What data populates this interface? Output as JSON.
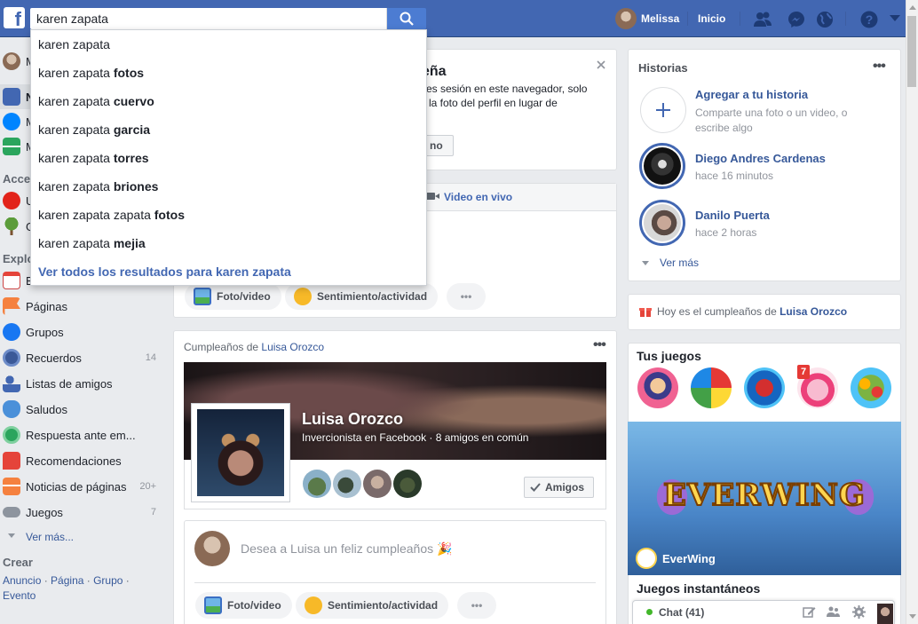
{
  "topbar": {
    "logo": "f",
    "search_value": "karen zapata",
    "user_name": "Melissa",
    "home_label": "Inicio",
    "icons": [
      "friend-requests-icon",
      "messenger-icon",
      "notifications-globe-icon",
      "help-icon",
      "account-menu-caret-icon"
    ]
  },
  "dropdown": {
    "suggestions": [
      {
        "base": "karen zapata",
        "bold": ""
      },
      {
        "base": "karen zapata ",
        "bold": "fotos"
      },
      {
        "base": "karen zapata ",
        "bold": "cuervo"
      },
      {
        "base": "karen zapata ",
        "bold": "garcia"
      },
      {
        "base": "karen zapata ",
        "bold": "torres"
      },
      {
        "base": "karen zapata ",
        "bold": "briones"
      },
      {
        "base": "karen zapata zapata ",
        "bold": "fotos"
      },
      {
        "base": "karen zapata ",
        "bold": "mejia"
      }
    ],
    "see_all": "Ver todos los resultados para karen zapata"
  },
  "left_sidebar": {
    "top_items": [
      {
        "label": "M",
        "icon": "profile-avatar-icon"
      },
      {
        "label": "N",
        "icon": "news-feed-icon"
      },
      {
        "label": "M",
        "icon": "messenger-icon"
      },
      {
        "label": "M",
        "icon": "marketplace-icon"
      }
    ],
    "shortcuts_header": "Acce",
    "shortcuts": [
      {
        "label": "U",
        "icon": "uno-game-icon"
      },
      {
        "label": "G",
        "icon": "tree-icon"
      }
    ],
    "explore_header": "Explo",
    "explore": [
      {
        "label": "E",
        "icon": "calendar-icon",
        "count": ""
      },
      {
        "label": "Páginas",
        "icon": "flag-icon",
        "count": ""
      },
      {
        "label": "Grupos",
        "icon": "groups-icon",
        "count": ""
      },
      {
        "label": "Recuerdos",
        "icon": "memories-clock-icon",
        "count": "14"
      },
      {
        "label": "Listas de amigos",
        "icon": "friend-lists-icon",
        "count": ""
      },
      {
        "label": "Saludos",
        "icon": "wave-hand-icon",
        "count": ""
      },
      {
        "label": "Respuesta ante em...",
        "icon": "crisis-response-icon",
        "count": ""
      },
      {
        "label": "Recomendaciones",
        "icon": "recommendations-icon",
        "count": ""
      },
      {
        "label": "Noticias de páginas",
        "icon": "pages-feed-icon",
        "count": "20+"
      },
      {
        "label": "Juegos",
        "icon": "gamepad-icon",
        "count": "7"
      }
    ],
    "see_more": "Ver más...",
    "create_header": "Crear",
    "create_links": [
      "Anuncio",
      "Página",
      "Grupo",
      "Evento"
    ]
  },
  "password_card": {
    "title": "eña",
    "text_line1": "es sesión en este navegador, solo",
    "text_line2": "la foto del perfil en lugar de",
    "button": "no"
  },
  "composer": {
    "live_label": "Video en vivo",
    "photo_label": "Foto/video",
    "feeling_label": "Sentimiento/actividad"
  },
  "birthday_card": {
    "header_prefix": "Cumpleaños de ",
    "header_name": "Luisa Orozco",
    "name": "Luisa Orozco",
    "subtitle": "Invercionista en Facebook · 8 amigos en común",
    "friends_button": "Amigos",
    "wish_placeholder": "Desea a Luisa un feliz cumpleaños 🎉",
    "photo_label": "Foto/video",
    "feeling_label": "Sentimiento/actividad"
  },
  "stories": {
    "title": "Historias",
    "add_title": "Agregar a tu historia",
    "add_sub": "Comparte una foto o un video, o escribe algo",
    "items": [
      {
        "name": "Diego Andres Cardenas",
        "time": "hace 16 minutos"
      },
      {
        "name": "Danilo Puerta",
        "time": "hace 2 horas"
      }
    ],
    "see_more": "Ver más"
  },
  "birthday_notice": {
    "prefix": "Hoy es el cumpleaños de ",
    "name": "Luisa Orozco"
  },
  "games": {
    "title": "Tus juegos",
    "badge": "7",
    "featured_name": "EverWing",
    "featured_logo": "EVERWING",
    "instant_title": "Juegos instantáneos"
  },
  "chat": {
    "label": "Chat (41)"
  },
  "colors": {
    "brand": "#4267b2",
    "link": "#365899",
    "online": "#42b72a"
  }
}
